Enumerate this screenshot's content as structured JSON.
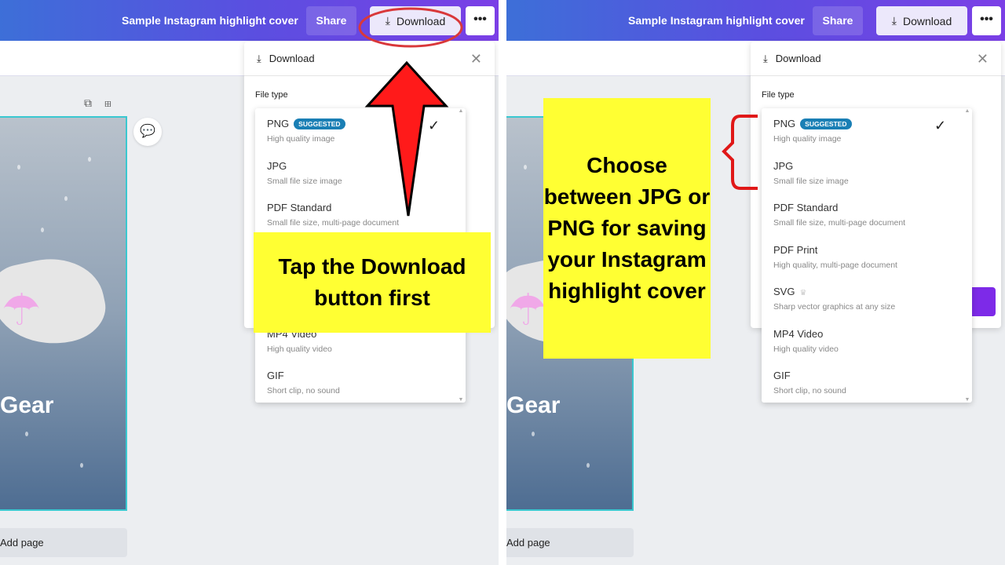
{
  "header": {
    "title": "Sample Instagram highlight cover",
    "share": "Share",
    "download": "Download",
    "more": "•••"
  },
  "canvas": {
    "add_page": "Add page",
    "design_text": "Gear"
  },
  "download_panel": {
    "title": "Download",
    "file_type_label": "File type"
  },
  "file_types": [
    {
      "name": "PNG",
      "desc": "High quality image",
      "badge": "SUGGESTED",
      "selected": true
    },
    {
      "name": "JPG",
      "desc": "Small file size image"
    },
    {
      "name": "PDF Standard",
      "desc": "Small file size, multi-page document"
    },
    {
      "name": "PDF Print",
      "desc": "High quality, multi-page document"
    },
    {
      "name": "SVG",
      "desc": "Sharp vector graphics at any size",
      "premium": true
    },
    {
      "name": "MP4 Video",
      "desc": "High quality video"
    },
    {
      "name": "GIF",
      "desc": "Short clip, no sound"
    }
  ],
  "callouts": {
    "left": "Tap the Download button first",
    "right": "Choose between JPG or PNG for saving your Instagram highlight cover"
  },
  "colors": {
    "header_start": "#3d6fd8",
    "header_end": "#7b3fe6",
    "callout": "#ffff33",
    "arrow": "#ff1a1a",
    "badge": "#1a7fb5",
    "accent": "#7d2ae8"
  }
}
